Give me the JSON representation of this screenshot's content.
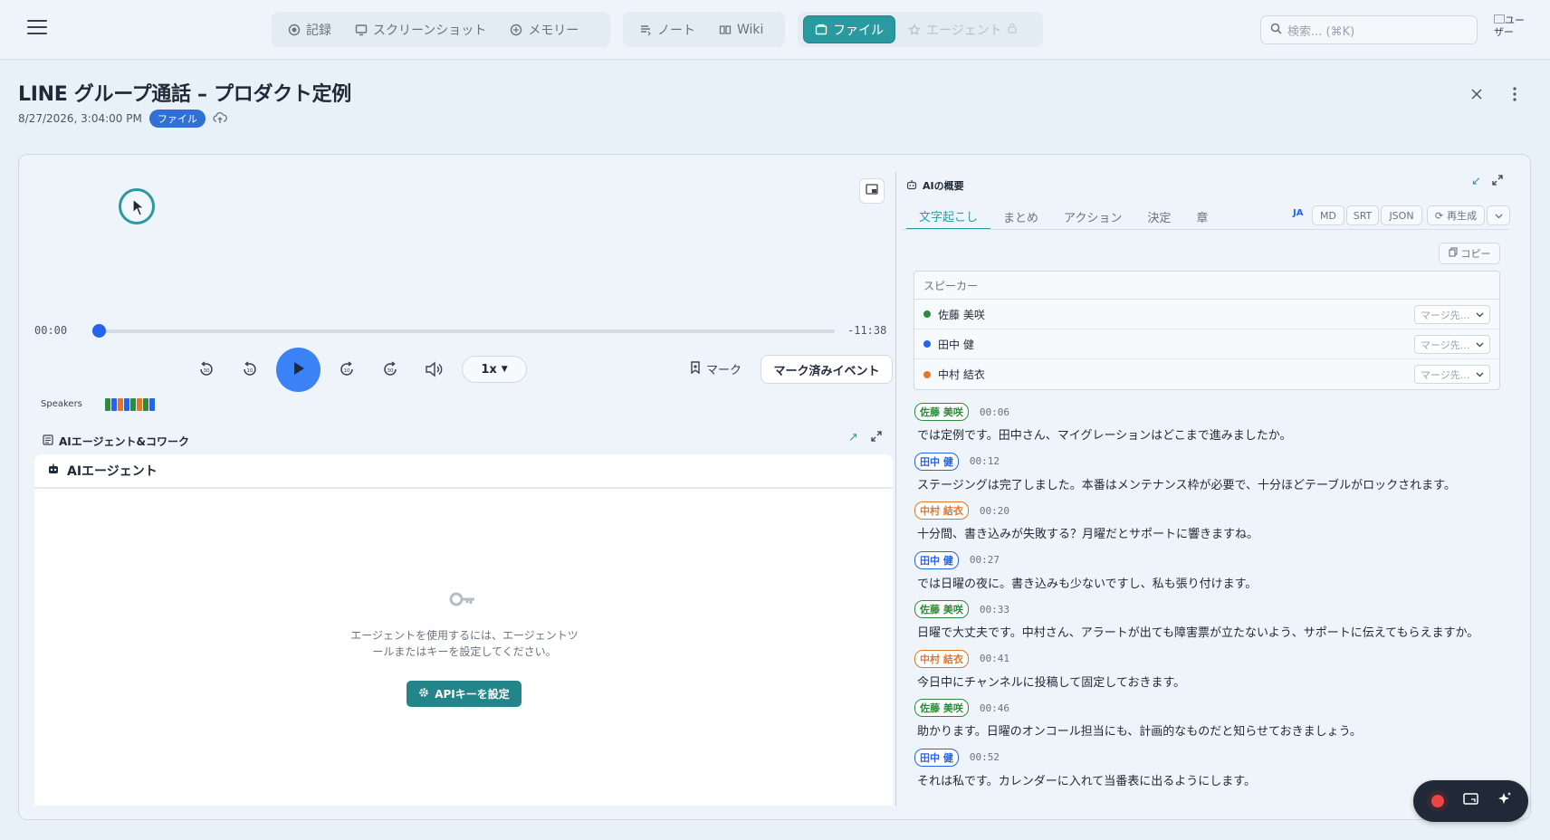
{
  "nav": {
    "groups": [
      [
        {
          "label": "記録",
          "icon": "record-icon"
        },
        {
          "label": "スクリーンショット",
          "icon": "monitor-icon"
        },
        {
          "label": "メモリー",
          "icon": "memory-icon"
        }
      ],
      [
        {
          "label": "ノート",
          "icon": "note-icon"
        },
        {
          "label": "Wiki",
          "icon": "book-icon"
        }
      ],
      [
        {
          "label": "ファイル",
          "icon": "folder-icon",
          "active": true
        },
        {
          "label": "エージェント",
          "icon": "agent-icon",
          "disabled": true
        }
      ]
    ],
    "search_placeholder": "検索... (⌘K)",
    "avatar_alt": "ユーザー"
  },
  "header": {
    "title": "LINE グループ通話 – プロダクト定例",
    "datetime": "8/27/2026, 3:04:00 PM",
    "badge": "ファイル"
  },
  "player": {
    "current_time": "00:00",
    "remaining_time": "-11:38",
    "progress": 0.0,
    "speed": "1x",
    "mark_label": "マーク",
    "marked_events_label": "マーク済みイベント",
    "speakers_label": "Speakers"
  },
  "agent": {
    "section_title": "AIエージェント&コワーク",
    "panel_title": "AIエージェント",
    "message_line1": "エージェントを使用するには、エージェントツ",
    "message_line2": "ールまたはキーを設定してください。",
    "api_button": "APIキーを設定"
  },
  "summary": {
    "title": "AIの概要",
    "tabs": [
      "文字起こし",
      "まとめ",
      "アクション",
      "決定",
      "章"
    ],
    "active_tab": 0,
    "lang": "JA",
    "formats": [
      "MD",
      "SRT",
      "JSON"
    ],
    "regenerate": "再生成",
    "copy": "コピー",
    "speakers_header": "スピーカー",
    "merge_placeholder": "マージ先...",
    "speakers": [
      {
        "name": "佐藤 美咲",
        "color": "#2e8b3e"
      },
      {
        "name": "田中 健",
        "color": "#2563eb"
      },
      {
        "name": "中村 結衣",
        "color": "#e2772b"
      }
    ]
  },
  "transcript": [
    {
      "speaker": "佐藤 美咲",
      "color": "#2e8b3e",
      "time": "00:06",
      "text": "では定例です。田中さん、マイグレーションはどこまで進みましたか。"
    },
    {
      "speaker": "田中 健",
      "color": "#2563eb",
      "time": "00:12",
      "text": "ステージングは完了しました。本番はメンテナンス枠が必要で、十分ほどテーブルがロックされます。"
    },
    {
      "speaker": "中村 結衣",
      "color": "#e2772b",
      "time": "00:20",
      "text": "十分間、書き込みが失敗する？月曜だとサポートに響きますね。"
    },
    {
      "speaker": "田中 健",
      "color": "#2563eb",
      "time": "00:27",
      "text": "では日曜の夜に。書き込みも少ないですし、私も張り付けます。"
    },
    {
      "speaker": "佐藤 美咲",
      "color": "#2e8b3e",
      "time": "00:33",
      "text": "日曜で大丈夫です。中村さん、アラートが出ても障害票が立たないよう、サポートに伝えてもらえますか。"
    },
    {
      "speaker": "中村 結衣",
      "color": "#e2772b",
      "time": "00:41",
      "text": "今日中にチャンネルに投稿して固定しておきます。"
    },
    {
      "speaker": "佐藤 美咲",
      "color": "#2e8b3e",
      "time": "00:46",
      "text": "助かります。日曜のオンコール担当にも、計画的なものだと知らせておきましょう。"
    },
    {
      "speaker": "田中 健",
      "color": "#2563eb",
      "time": "00:52",
      "text": "それは私です。カレンダーに入れて当番表に出るようにします。"
    }
  ],
  "speaker_strip_colors": [
    "#2e8b3e",
    "#2563eb",
    "#e2772b",
    "#2563eb",
    "#2e8b3e",
    "#e2772b",
    "#2e8b3e",
    "#2563eb"
  ],
  "colors": {
    "accent": "#2b9aa0",
    "play": "#3b82f6",
    "badge": "#2f6fd6"
  }
}
